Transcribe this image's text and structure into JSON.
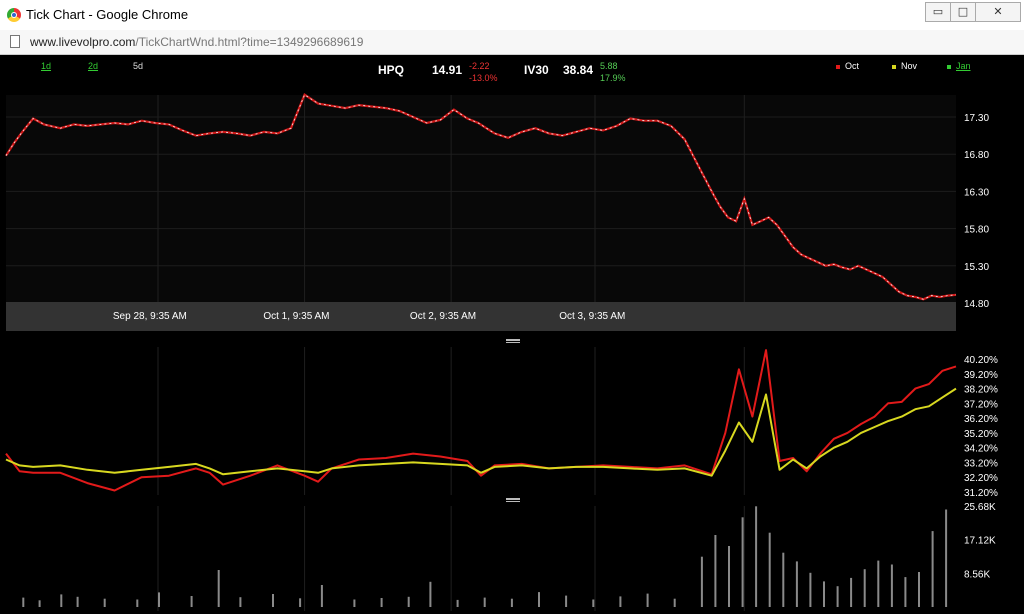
{
  "window": {
    "title": "Tick Chart - Google Chrome",
    "minimize_glyph": "▭",
    "maximize_glyph": "□",
    "close_glyph": "✕"
  },
  "address": {
    "host": "www.livevolpro.com",
    "path": "/TickChartWnd.html?time=1349296689619"
  },
  "toolbar": {
    "timeframes": [
      "1d",
      "2d",
      "5d"
    ],
    "selected": "5d"
  },
  "quote": {
    "symbol": "HPQ",
    "price": "14.91",
    "change": "-2.22",
    "change_pct": "-13.0%",
    "iv_label": "IV30",
    "iv_value": "38.84",
    "iv_change": "5.88",
    "iv_change_pct": "17.9%"
  },
  "legend": [
    {
      "label": "Oct",
      "color": "#e21a1a"
    },
    {
      "label": "Nov",
      "color": "#d8d820"
    },
    {
      "label": "Jan",
      "color": "#33cc33"
    }
  ],
  "chart_data": [
    {
      "type": "line",
      "name": "price",
      "x_labels": [
        "Sep 28, 9:35 AM",
        "Oct 1, 9:35 AM",
        "Oct 2, 9:35 AM",
        "Oct 3, 9:35 AM"
      ],
      "y_ticks": [
        "17.30",
        "16.80",
        "16.30",
        "15.80",
        "15.30",
        "14.80"
      ],
      "ylim": [
        14.8,
        17.3
      ],
      "x": [
        0,
        0.3,
        0.6,
        1.0,
        1.4,
        2.0,
        2.5,
        3.0,
        3.5,
        4.0,
        4.5,
        5.0,
        5.5,
        6.0,
        6.5,
        7.0,
        7.5,
        8.0,
        8.5,
        9.0,
        9.5,
        10.0,
        10.5,
        11.0,
        11.5,
        12.0,
        12.5,
        13.0,
        13.5,
        14.0,
        14.5,
        15.0,
        15.5,
        16.0,
        16.5,
        17.0,
        17.4,
        17.7,
        18.0,
        18.5,
        19.0,
        19.5,
        20.0,
        20.5,
        21.0,
        21.5,
        22.0,
        22.5,
        23.0,
        23.5,
        24.0,
        24.5,
        25.0,
        25.5,
        26.0,
        26.3,
        26.6,
        26.9,
        27.2,
        27.5,
        27.8,
        28.1,
        28.4,
        28.7,
        29.0,
        29.3,
        29.6,
        29.9,
        30.2,
        30.5,
        30.8,
        31.1,
        31.4,
        31.7,
        32.0,
        32.3,
        32.6,
        32.9,
        33.2,
        33.5,
        33.8,
        34.1,
        34.4,
        34.7,
        35.0
      ],
      "y": [
        16.78,
        16.95,
        17.1,
        17.28,
        17.2,
        17.15,
        17.2,
        17.18,
        17.2,
        17.22,
        17.2,
        17.25,
        17.22,
        17.2,
        17.12,
        17.05,
        17.08,
        17.1,
        17.08,
        17.05,
        17.1,
        17.08,
        17.15,
        17.6,
        17.48,
        17.45,
        17.42,
        17.46,
        17.44,
        17.42,
        17.38,
        17.3,
        17.22,
        17.26,
        17.4,
        17.28,
        17.22,
        17.15,
        17.08,
        17.02,
        17.1,
        17.15,
        17.08,
        17.05,
        17.1,
        17.15,
        17.12,
        17.18,
        17.28,
        17.25,
        17.25,
        17.18,
        17.0,
        16.65,
        16.3,
        16.1,
        15.95,
        15.9,
        16.2,
        15.85,
        15.9,
        15.95,
        15.85,
        15.7,
        15.55,
        15.45,
        15.4,
        15.35,
        15.3,
        15.32,
        15.28,
        15.25,
        15.3,
        15.25,
        15.2,
        15.15,
        15.05,
        14.95,
        14.9,
        14.88,
        14.85,
        14.9,
        14.88,
        14.9,
        14.91
      ]
    },
    {
      "type": "line",
      "name": "iv30",
      "y_ticks": [
        "40.20%",
        "39.20%",
        "38.20%",
        "37.20%",
        "36.20%",
        "35.20%",
        "34.20%",
        "33.20%",
        "32.20%",
        "31.20%"
      ],
      "ylim": [
        31.2,
        40.2
      ],
      "x": [
        0,
        0.5,
        1.0,
        2.0,
        3.0,
        4.0,
        5.0,
        6.0,
        7.0,
        7.5,
        8.0,
        9.0,
        10.0,
        11.0,
        11.5,
        12.0,
        13.0,
        14.0,
        15.0,
        16.0,
        17.0,
        17.5,
        18.0,
        19.0,
        20.0,
        21.0,
        22.0,
        23.0,
        24.0,
        25.0,
        26.0,
        26.5,
        27.0,
        27.5,
        28.0,
        28.5,
        29.0,
        29.5,
        30.0,
        30.5,
        31.0,
        31.5,
        32.0,
        32.5,
        33.0,
        33.5,
        34.0,
        34.5,
        35.0
      ],
      "series": [
        {
          "label": "Oct",
          "values": [
            33.8,
            32.6,
            32.5,
            32.5,
            31.8,
            31.3,
            32.2,
            32.3,
            32.8,
            32.5,
            31.7,
            32.3,
            33.0,
            32.3,
            31.9,
            32.8,
            33.4,
            33.5,
            33.8,
            33.6,
            33.3,
            32.3,
            33.0,
            33.1,
            32.8,
            32.9,
            33.0,
            32.9,
            32.8,
            33.0,
            32.4,
            35.2,
            39.5,
            36.3,
            40.8,
            33.3,
            33.5,
            32.6,
            33.8,
            34.8,
            35.2,
            35.8,
            36.3,
            37.2,
            37.3,
            38.2,
            38.5,
            39.4,
            39.7
          ]
        },
        {
          "label": "Nov",
          "values": [
            33.4,
            33.0,
            32.9,
            33.0,
            32.7,
            32.5,
            32.7,
            32.9,
            33.1,
            32.8,
            32.4,
            32.6,
            32.8,
            32.6,
            32.5,
            32.8,
            33.0,
            33.1,
            33.2,
            33.1,
            33.0,
            32.5,
            32.9,
            33.0,
            32.8,
            32.9,
            32.9,
            32.8,
            32.7,
            32.8,
            32.3,
            34.0,
            35.9,
            34.6,
            37.8,
            32.7,
            33.4,
            32.8,
            33.6,
            34.2,
            34.6,
            35.2,
            35.6,
            36.0,
            36.3,
            36.8,
            37.0,
            37.6,
            38.2
          ]
        }
      ]
    },
    {
      "type": "bar",
      "name": "volume",
      "y_ticks": [
        "25.68K",
        "17.12K",
        "8.56K"
      ],
      "ylim": [
        0,
        25680
      ],
      "x": [
        0.6,
        1.2,
        2.0,
        2.6,
        3.6,
        4.8,
        5.6,
        6.8,
        7.8,
        8.6,
        9.8,
        10.8,
        11.6,
        12.8,
        13.8,
        14.8,
        15.6,
        16.6,
        17.6,
        18.6,
        19.6,
        20.6,
        21.6,
        22.6,
        23.6,
        24.6,
        25.6,
        26.1,
        26.6,
        27.1,
        27.6,
        28.1,
        28.6,
        29.1,
        29.6,
        30.1,
        30.6,
        31.1,
        31.6,
        32.1,
        32.6,
        33.1,
        33.6,
        34.1,
        34.6
      ],
      "values": [
        2400,
        1700,
        3200,
        2600,
        2100,
        1900,
        3700,
        2800,
        9400,
        2500,
        3300,
        2200,
        5600,
        1900,
        2300,
        2600,
        6400,
        1800,
        2400,
        2100,
        3800,
        2900,
        1900,
        2700,
        3400,
        2100,
        12800,
        18300,
        15500,
        22800,
        25600,
        18900,
        13800,
        11600,
        8700,
        6500,
        5300,
        7400,
        9600,
        11800,
        10800,
        7600,
        8900,
        19300,
        24800
      ]
    }
  ]
}
